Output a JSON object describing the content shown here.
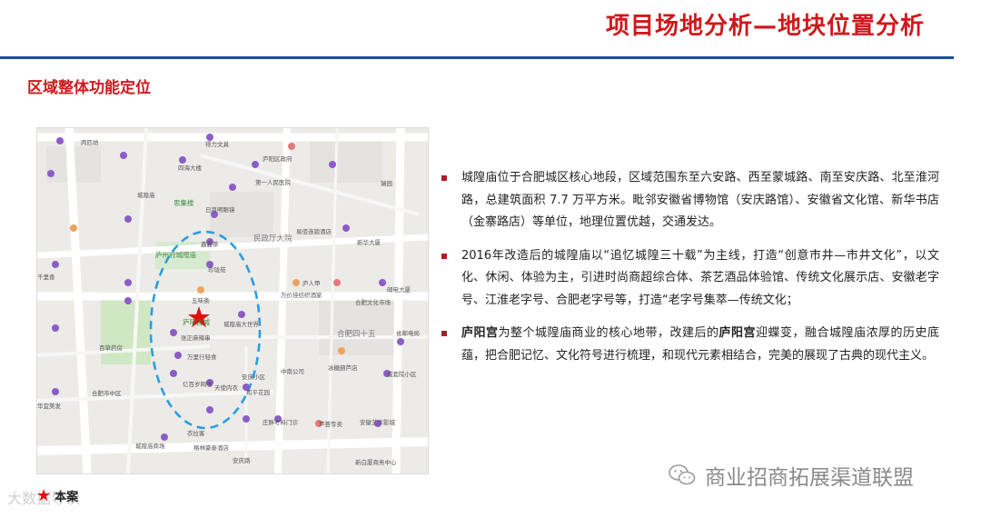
{
  "header": {
    "title": "项目场地分析—地块位置分析"
  },
  "section": {
    "title": "区域整体功能定位"
  },
  "map": {
    "labels": {
      "l1": "丙匹坊",
      "l2": "得力文具",
      "l3": "四海大楼",
      "l4": "庐阳区政府",
      "l5": "城隍庙",
      "l6": "三孝口",
      "l7": "第一人民医院",
      "l8": "城隍庙古玩城",
      "l9": "思集楼",
      "l10": "日月明眼镜",
      "l11": "庐州府城隍庙",
      "l12": "鑫鑫茶",
      "l13": "珍珑苑",
      "l14": "民政厅大院",
      "l15": "易佰连锁酒店",
      "l16": "新华大厦",
      "l17": "庐人甲",
      "l18": "万价佳纺织酒家",
      "l19": "合肥文化市场",
      "l20": "安庆路",
      "l21": "城隍庙大世界",
      "l22": "五味斋",
      "l23": "张正麻辣串",
      "l24": "百草药房",
      "l25": "万里行轻食",
      "l26": "亿百岁网咖",
      "l27": "天使内衣",
      "l28": "合肥四十五",
      "l29": "合肥义务街学",
      "l30": "冰糖葫芦店",
      "l31": "成套院小区",
      "l32": "和平花园",
      "l33": "庐阳古城",
      "l34": "安庆路西",
      "l35": "中南公司",
      "l36": "安庆小区",
      "l37": "衣拉客",
      "l38": "格林豪泰酒店",
      "l39": "安徽艺术影城",
      "l40": "芦荟专卖",
      "l41": "新白厦商务中心",
      "l42": "瑞园",
      "l43": "邮电大厦",
      "l44": "省邮电局",
      "l45": "庄胖考料门诊",
      "l46": "华",
      "l47": "安庆路",
      "l48": "城隍庙商场",
      "l49": "益鑫阁",
      "l50": "庐阳区",
      "l51": "庐州书院",
      "l52": "沃尔玛",
      "l53": "蓓蕾书苑",
      "l54": "亿邦大厦",
      "l55": "城隍庙古玩城",
      "l56": "文庙",
      "l57": "千里香",
      "l58": "肯德基",
      "l59": "中国联通",
      "l60": "合肥市中区",
      "l61": "百草药房",
      "l62": "华宜美发",
      "l63": "城隍庙市场",
      "l64": "合肥四十五中",
      "l65": "民政厅",
      "l66": "城隍庙古玩城"
    }
  },
  "bullets": [
    {
      "text": "城隍庙位于合肥城区核心地段，区域范围东至六安路、西至蒙城路、南至安庆路、北至淮河路，总建筑面积 7.7 万平方米。毗邻安徽省博物馆（安庆路馆）、安徽省文化馆、新华书店（金寨路店）等单位，地理位置优越，交通发达。"
    },
    {
      "text": "2016年改造后的城隍庙以“追忆城隍三十载”为主线，打造“创意市井—市井文化”，以文化、休闲、体验为主，引进时尚商超综合体、茶艺酒品体验馆、传统文化展示店、安徽老字号、江淮老字号、合肥老字号等，打造“老字号集萃—传统文化；"
    },
    {
      "b1": "庐阳宫",
      "t1": "为整个城隍庙商业的核心地带，改建后的",
      "b2": "庐阳宫",
      "t2": "迎蝶变，融合城隍庙浓厚的历史底蕴，把合肥记忆、文化符号进行梳理，和现代元素相结合，完美的展现了古典的现代主义。"
    }
  ],
  "legend": {
    "star": "★",
    "label": "本案"
  },
  "watermark": {
    "text": "大数据导读"
  },
  "wechat": {
    "text": "商业招商拓展渠道联盟"
  },
  "colors": {
    "red": "#d0181c",
    "blue": "#1b4e9a",
    "dash": "#2a9de0"
  }
}
